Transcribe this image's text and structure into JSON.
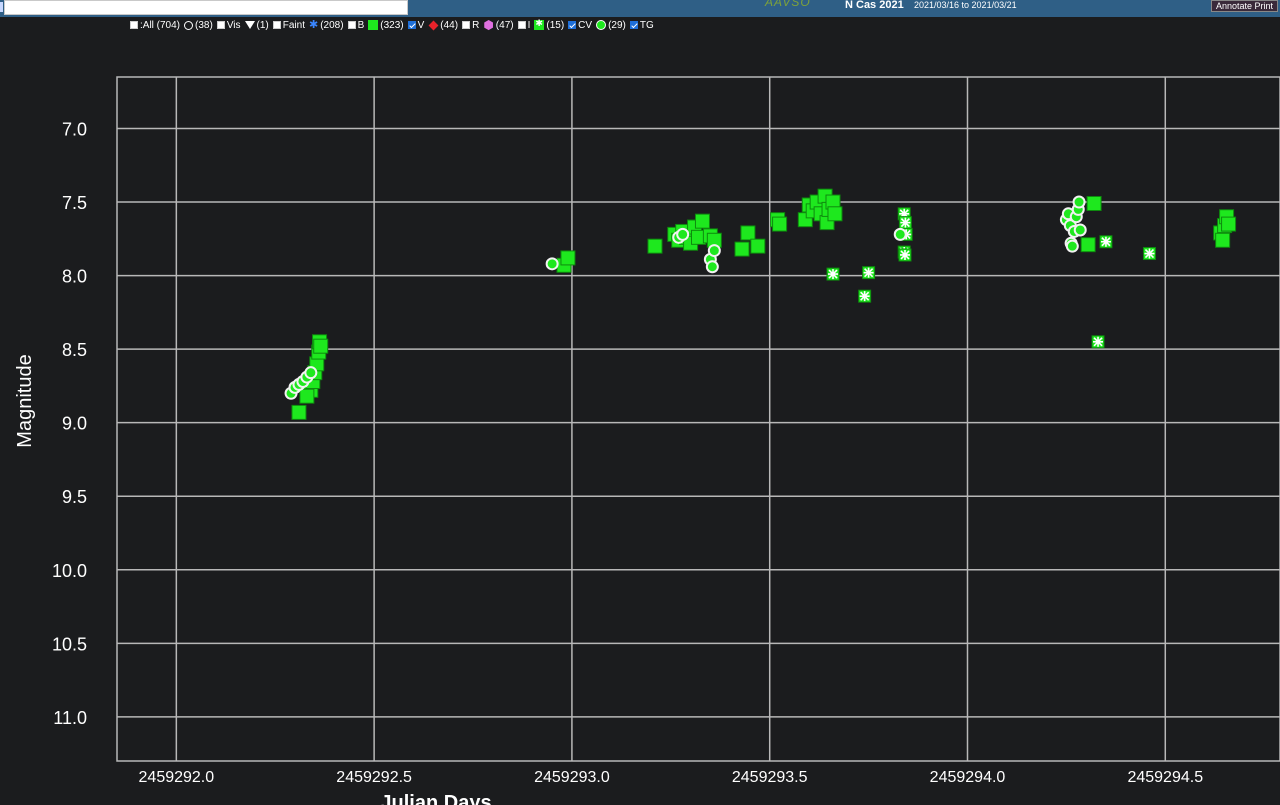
{
  "header": {
    "logo_text": "AAVSO",
    "star_name": "N Cas 2021",
    "date_range": "2021/03/16 to 2021/03/21",
    "annotate_label": "Annotate Print"
  },
  "legend": {
    "items": [
      {
        "label": ":All (704)",
        "checked": false,
        "symbol": "none"
      },
      {
        "label": "(38)",
        "symbol": "circle"
      },
      {
        "label": "Vis",
        "checked": false,
        "symbol": "none"
      },
      {
        "label": "(1)",
        "symbol": "triangle-down"
      },
      {
        "label": "Faint",
        "checked": false,
        "symbol": "none"
      },
      {
        "label": "(208)",
        "symbol": "star"
      },
      {
        "label": "B",
        "checked": false,
        "symbol": "none"
      },
      {
        "label": "(323)",
        "symbol": "square"
      },
      {
        "label": "V",
        "checked": true,
        "symbol": "none"
      },
      {
        "label": "(44)",
        "symbol": "diamond"
      },
      {
        "label": "R",
        "checked": false,
        "symbol": "none"
      },
      {
        "label": "(47)",
        "symbol": "hexagon"
      },
      {
        "label": "I",
        "checked": false,
        "symbol": "none"
      },
      {
        "label": "(15)",
        "symbol": "square-x"
      },
      {
        "label": "CV",
        "checked": true,
        "symbol": "none"
      },
      {
        "label": "(29)",
        "symbol": "green-circle"
      },
      {
        "label": "TG",
        "checked": true,
        "symbol": "none"
      }
    ]
  },
  "chart_data": {
    "type": "scatter",
    "xlabel": "Julian Days",
    "ylabel": "Magnitude",
    "xlim": [
      2459291.85,
      2459294.79
    ],
    "ylim": [
      11.3,
      6.65
    ],
    "y_inverted": true,
    "x_ticks": [
      "2459292.0",
      "2459292.5",
      "2459293.0",
      "2459293.5",
      "2459294.0",
      "2459294.5"
    ],
    "x_tick_values": [
      2459292.0,
      2459292.5,
      2459293.0,
      2459293.5,
      2459294.0,
      2459294.5
    ],
    "y_ticks": [
      "7.0",
      "7.5",
      "8.0",
      "8.5",
      "9.0",
      "9.5",
      "10.0",
      "10.5",
      "11.0"
    ],
    "y_tick_values": [
      7.0,
      7.5,
      8.0,
      8.5,
      9.0,
      9.5,
      10.0,
      10.5,
      11.0
    ],
    "grid": true,
    "colors": {
      "background": "#1b1c1e",
      "grid": "#b8b8b8",
      "marker": "#1ee81e",
      "marker_edge": "#0e8a0e"
    },
    "series": [
      {
        "band": "V",
        "marker": "square",
        "points": [
          [
            2459292.31,
            8.93
          ],
          [
            2459292.34,
            8.78
          ],
          [
            2459292.345,
            8.72
          ],
          [
            2459292.35,
            8.66
          ],
          [
            2459292.355,
            8.6
          ],
          [
            2459292.36,
            8.52
          ],
          [
            2459292.362,
            8.45
          ],
          [
            2459292.365,
            8.48
          ],
          [
            2459292.33,
            8.82
          ],
          [
            2459292.98,
            7.93
          ],
          [
            2459292.99,
            7.88
          ],
          [
            2459293.21,
            7.8
          ],
          [
            2459293.26,
            7.72
          ],
          [
            2459293.27,
            7.76
          ],
          [
            2459293.28,
            7.7
          ],
          [
            2459293.29,
            7.74
          ],
          [
            2459293.3,
            7.78
          ],
          [
            2459293.31,
            7.67
          ],
          [
            2459293.32,
            7.74
          ],
          [
            2459293.33,
            7.63
          ],
          [
            2459293.35,
            7.73
          ],
          [
            2459293.36,
            7.76
          ],
          [
            2459293.43,
            7.82
          ],
          [
            2459293.445,
            7.71
          ],
          [
            2459293.47,
            7.8
          ],
          [
            2459293.52,
            7.62
          ],
          [
            2459293.525,
            7.65
          ],
          [
            2459293.59,
            7.62
          ],
          [
            2459293.6,
            7.52
          ],
          [
            2459293.61,
            7.56
          ],
          [
            2459293.62,
            7.5
          ],
          [
            2459293.63,
            7.58
          ],
          [
            2459293.64,
            7.46
          ],
          [
            2459293.645,
            7.64
          ],
          [
            2459293.65,
            7.55
          ],
          [
            2459293.66,
            7.5
          ],
          [
            2459293.665,
            7.58
          ],
          [
            2459294.32,
            7.51
          ],
          [
            2459294.305,
            7.79
          ],
          [
            2459294.64,
            7.71
          ],
          [
            2459294.645,
            7.76
          ],
          [
            2459294.65,
            7.66
          ],
          [
            2459294.655,
            7.6
          ],
          [
            2459294.66,
            7.65
          ]
        ]
      },
      {
        "band": "CV",
        "marker": "square-x",
        "points": [
          [
            2459293.66,
            7.99
          ],
          [
            2459293.74,
            8.14
          ],
          [
            2459293.75,
            7.98
          ],
          [
            2459293.84,
            7.58
          ],
          [
            2459293.843,
            7.64
          ],
          [
            2459293.845,
            7.72
          ],
          [
            2459293.84,
            7.84
          ],
          [
            2459293.842,
            7.86
          ],
          [
            2459294.33,
            8.45
          ],
          [
            2459294.35,
            7.77
          ],
          [
            2459294.46,
            7.85
          ]
        ]
      },
      {
        "band": "TG",
        "marker": "green-circle",
        "points": [
          [
            2459292.29,
            8.8
          ],
          [
            2459292.3,
            8.76
          ],
          [
            2459292.31,
            8.74
          ],
          [
            2459292.32,
            8.72
          ],
          [
            2459292.33,
            8.69
          ],
          [
            2459292.34,
            8.66
          ],
          [
            2459292.95,
            7.92
          ],
          [
            2459293.27,
            7.74
          ],
          [
            2459293.28,
            7.72
          ],
          [
            2459293.35,
            7.89
          ],
          [
            2459293.355,
            7.94
          ],
          [
            2459293.36,
            7.83
          ],
          [
            2459293.83,
            7.72
          ],
          [
            2459294.25,
            7.62
          ],
          [
            2459294.255,
            7.58
          ],
          [
            2459294.26,
            7.66
          ],
          [
            2459294.262,
            7.78
          ],
          [
            2459294.265,
            7.8
          ],
          [
            2459294.27,
            7.7
          ],
          [
            2459294.275,
            7.6
          ],
          [
            2459294.28,
            7.55
          ],
          [
            2459294.282,
            7.5
          ],
          [
            2459294.285,
            7.69
          ]
        ]
      }
    ]
  }
}
